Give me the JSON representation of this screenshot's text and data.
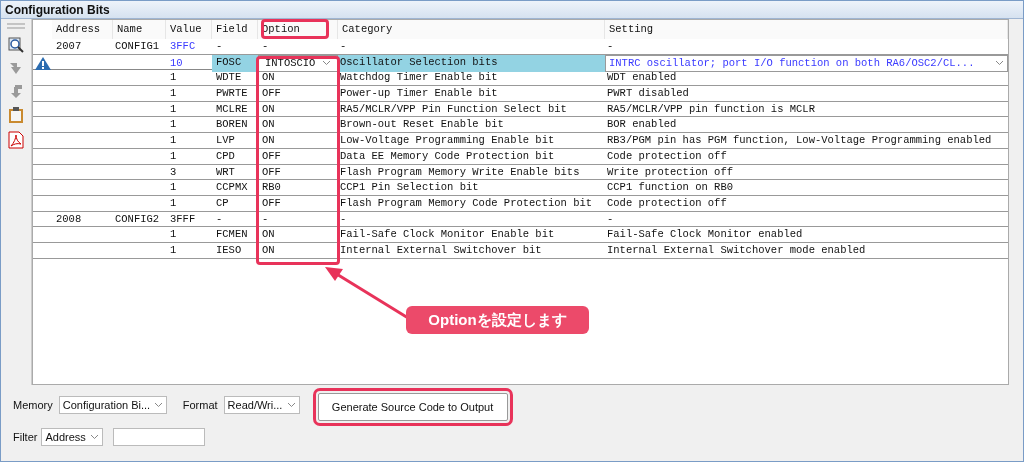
{
  "window": {
    "title": "Configuration Bits"
  },
  "table": {
    "columns": [
      "Address",
      "Name",
      "Value",
      "Field",
      "Option",
      "Category",
      "Setting"
    ],
    "rows": [
      {
        "address": "2007",
        "name": "CONFIG1",
        "value": "3FFC",
        "field": "-",
        "option": "-",
        "category": "-",
        "setting": "-",
        "modified": true,
        "selected": false,
        "warning": false
      },
      {
        "value": "10",
        "field": "FOSC",
        "option": "INTOSCIO",
        "category": "Oscillator Selection bits",
        "setting": "INTRC oscillator; port I/O function on both RA6/OSC2/CL...",
        "modified": true,
        "selected": true,
        "warning": true
      },
      {
        "value": "1",
        "field": "WDTE",
        "option": "ON",
        "category": "Watchdog Timer Enable bit",
        "setting": "WDT enabled",
        "modified": false,
        "selected": false,
        "warning": false
      },
      {
        "value": "1",
        "field": "PWRTE",
        "option": "OFF",
        "category": "Power-up Timer Enable bit",
        "setting": "PWRT disabled",
        "modified": false,
        "selected": false,
        "warning": false
      },
      {
        "value": "1",
        "field": "MCLRE",
        "option": "ON",
        "category": "RA5/MCLR/VPP Pin Function Select bit",
        "setting": "RA5/MCLR/VPP pin function is MCLR",
        "modified": false,
        "selected": false,
        "warning": false
      },
      {
        "value": "1",
        "field": "BOREN",
        "option": "ON",
        "category": "Brown-out Reset Enable bit",
        "setting": "BOR enabled",
        "modified": false,
        "selected": false,
        "warning": false
      },
      {
        "value": "1",
        "field": "LVP",
        "option": "ON",
        "category": "Low-Voltage Programming Enable bit",
        "setting": "RB3/PGM pin has PGM function, Low-Voltage Programming enabled",
        "modified": false,
        "selected": false,
        "warning": false
      },
      {
        "value": "1",
        "field": "CPD",
        "option": "OFF",
        "category": "Data EE Memory Code Protection bit",
        "setting": "Code protection off",
        "modified": false,
        "selected": false,
        "warning": false
      },
      {
        "value": "3",
        "field": "WRT",
        "option": "OFF",
        "category": "Flash Program Memory Write Enable bits",
        "setting": "Write protection off",
        "modified": false,
        "selected": false,
        "warning": false
      },
      {
        "value": "1",
        "field": "CCPMX",
        "option": "RB0",
        "category": "CCP1 Pin Selection bit",
        "setting": "CCP1 function on RB0",
        "modified": false,
        "selected": false,
        "warning": false
      },
      {
        "value": "1",
        "field": "CP",
        "option": "OFF",
        "category": "Flash Program Memory Code Protection bit",
        "setting": "Code protection off",
        "modified": false,
        "selected": false,
        "warning": false
      },
      {
        "address": "2008",
        "name": "CONFIG2",
        "value": "3FFF",
        "field": "-",
        "option": "-",
        "category": "-",
        "setting": "-",
        "modified": false,
        "selected": false,
        "warning": false
      },
      {
        "value": "1",
        "field": "FCMEN",
        "option": "ON",
        "category": "Fail-Safe Clock Monitor Enable bit",
        "setting": "Fail-Safe Clock Monitor enabled",
        "modified": false,
        "selected": false,
        "warning": false
      },
      {
        "value": "1",
        "field": "IESO",
        "option": "ON",
        "category": "Internal External Switchover bit",
        "setting": "Internal External Switchover mode enabled",
        "modified": false,
        "selected": false,
        "warning": false
      }
    ]
  },
  "controls": {
    "memory": {
      "label": "Memory",
      "value": "Configuration Bi..."
    },
    "format": {
      "label": "Format",
      "value": "Read/Wri..."
    },
    "generate_button": "Generate Source Code to Output",
    "filter": {
      "label": "Filter",
      "value": "Address"
    }
  },
  "annotation": {
    "text": "Optionを設定します"
  }
}
